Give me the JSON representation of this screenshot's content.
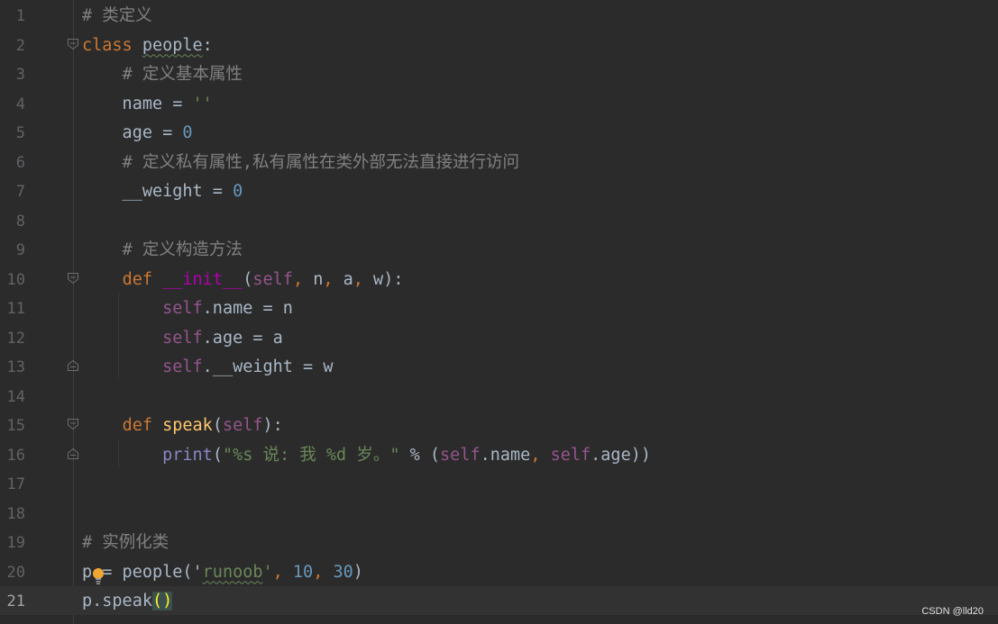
{
  "editor": {
    "current_line": 21,
    "lines": [
      {
        "n": "1",
        "tokens": [
          {
            "t": "# 类定义",
            "c": "cmt"
          }
        ]
      },
      {
        "n": "2",
        "tokens": [
          {
            "t": "class",
            "c": "kw"
          },
          {
            "t": " "
          },
          {
            "t": "people",
            "c": "typo"
          },
          {
            "t": ":"
          }
        ]
      },
      {
        "n": "3",
        "tokens": [
          {
            "t": "    "
          },
          {
            "t": "# 定义基本属性",
            "c": "cmt"
          }
        ]
      },
      {
        "n": "4",
        "tokens": [
          {
            "t": "    name = "
          },
          {
            "t": "''",
            "c": "str"
          }
        ]
      },
      {
        "n": "5",
        "tokens": [
          {
            "t": "    age = "
          },
          {
            "t": "0",
            "c": "num"
          }
        ]
      },
      {
        "n": "6",
        "tokens": [
          {
            "t": "    "
          },
          {
            "t": "# 定义私有属性,私有属性在类外部无法直接进行访问",
            "c": "cmt"
          }
        ]
      },
      {
        "n": "7",
        "tokens": [
          {
            "t": "    __weight = "
          },
          {
            "t": "0",
            "c": "num"
          }
        ]
      },
      {
        "n": "8",
        "tokens": []
      },
      {
        "n": "9",
        "tokens": [
          {
            "t": "    "
          },
          {
            "t": "# 定义构造方法",
            "c": "cmt"
          }
        ]
      },
      {
        "n": "10",
        "tokens": [
          {
            "t": "    "
          },
          {
            "t": "def",
            "c": "kw"
          },
          {
            "t": " "
          },
          {
            "t": "__init__",
            "c": "magic"
          },
          {
            "t": "("
          },
          {
            "t": "self",
            "c": "sf"
          },
          {
            "t": ",",
            "c": "kw"
          },
          {
            "t": " n"
          },
          {
            "t": ",",
            "c": "kw"
          },
          {
            "t": " a"
          },
          {
            "t": ",",
            "c": "kw"
          },
          {
            "t": " w):"
          }
        ]
      },
      {
        "n": "11",
        "tokens": [
          {
            "t": "        "
          },
          {
            "t": "self",
            "c": "sf"
          },
          {
            "t": ".name = n"
          }
        ]
      },
      {
        "n": "12",
        "tokens": [
          {
            "t": "        "
          },
          {
            "t": "self",
            "c": "sf"
          },
          {
            "t": ".age = a"
          }
        ]
      },
      {
        "n": "13",
        "tokens": [
          {
            "t": "        "
          },
          {
            "t": "self",
            "c": "sf"
          },
          {
            "t": ".__weight = w"
          }
        ]
      },
      {
        "n": "14",
        "tokens": []
      },
      {
        "n": "15",
        "tokens": [
          {
            "t": "    "
          },
          {
            "t": "def",
            "c": "kw"
          },
          {
            "t": " "
          },
          {
            "t": "speak",
            "c": "fn"
          },
          {
            "t": "("
          },
          {
            "t": "self",
            "c": "sf"
          },
          {
            "t": "):"
          }
        ]
      },
      {
        "n": "16",
        "tokens": [
          {
            "t": "        "
          },
          {
            "t": "print",
            "c": "bi"
          },
          {
            "t": "("
          },
          {
            "t": "\"%s 说: 我 %d 岁。\"",
            "c": "str"
          },
          {
            "t": " % ("
          },
          {
            "t": "self",
            "c": "sf"
          },
          {
            "t": ".name"
          },
          {
            "t": ",",
            "c": "kw"
          },
          {
            "t": " "
          },
          {
            "t": "self",
            "c": "sf"
          },
          {
            "t": ".age))"
          }
        ]
      },
      {
        "n": "17",
        "tokens": []
      },
      {
        "n": "18",
        "tokens": []
      },
      {
        "n": "19",
        "tokens": [
          {
            "t": "# 实例化类",
            "c": "cmt"
          }
        ]
      },
      {
        "n": "20",
        "tokens": [
          {
            "t": "p "
          },
          {
            "t": "= people("
          },
          {
            "t": "'"
          },
          {
            "t": "runoob",
            "c": "str typo"
          },
          {
            "t": "'",
            "c": "str"
          },
          {
            "t": ",",
            "c": "kw"
          },
          {
            "t": " "
          },
          {
            "t": "10",
            "c": "num"
          },
          {
            "t": ",",
            "c": "kw"
          },
          {
            "t": " "
          },
          {
            "t": "30",
            "c": "num"
          },
          {
            "t": ")"
          }
        ]
      },
      {
        "n": "21",
        "tokens": [
          {
            "t": "p.speak"
          },
          {
            "t": "()",
            "c": "brace-match"
          }
        ]
      }
    ]
  },
  "colors": {
    "background": "#2b2b2b",
    "current_line": "#323232",
    "keyword": "#cc7832",
    "self": "#94558d",
    "number": "#6897bb",
    "string": "#6a8759",
    "comment": "#808080",
    "function": "#ffc66d"
  },
  "icons": {
    "fold_open": "fold-open-icon",
    "fold_close": "fold-close-icon",
    "intention": "lightbulb-icon"
  },
  "watermark": "CSDN @lld20"
}
